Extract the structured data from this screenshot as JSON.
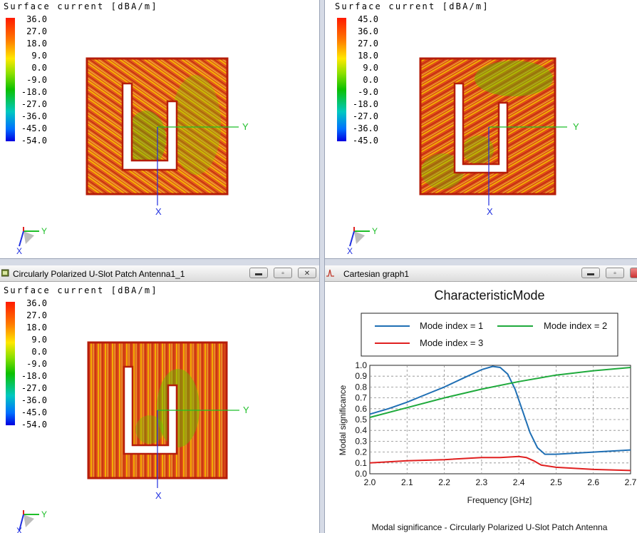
{
  "scale_title": "Surface current [dBA/m]",
  "panels": [
    {
      "scale": [
        "36.0",
        "27.0",
        "18.0",
        "9.0",
        "0.0",
        "-9.0",
        "-18.0",
        "-27.0",
        "-36.0",
        "-45.0",
        "-54.0"
      ],
      "axis_y": "Y",
      "axis_x": "X",
      "triad_y": "Y",
      "triad_x": "X"
    },
    {
      "scale": [
        "45.0",
        "36.0",
        "27.0",
        "18.0",
        "9.0",
        "0.0",
        "-9.0",
        "-18.0",
        "-27.0",
        "-36.0",
        "-45.0"
      ],
      "axis_y": "Y",
      "axis_x": "X",
      "triad_y": "Y",
      "triad_x": "X"
    },
    {
      "window_title": "Circularly Polarized  U-Slot Patch Antenna1_1",
      "scale": [
        "36.0",
        "27.0",
        "18.0",
        "9.0",
        "0.0",
        "-9.0",
        "-18.0",
        "-27.0",
        "-36.0",
        "-45.0",
        "-54.0"
      ],
      "axis_y": "Y",
      "axis_x": "X",
      "triad_y": "Y",
      "triad_x": "X"
    }
  ],
  "graph_window": {
    "title": "Cartesian graph1"
  },
  "colors": {
    "mode1": "#1f6fb4",
    "mode2": "#1faa3c",
    "mode3": "#e02020",
    "surface": "#d42a10",
    "titlebar": "#e4e4e4"
  },
  "chart_data": {
    "type": "line",
    "title": "CharacteristicMode",
    "xlabel": "Frequency [GHz]",
    "ylabel": "Modal significance",
    "caption": "Modal significance - Circularly Polarized U-Slot Patch Antenna",
    "xlim": [
      2.0,
      2.7
    ],
    "ylim": [
      0.0,
      1.0
    ],
    "xticks": [
      "2.0",
      "2.1",
      "2.2",
      "2.3",
      "2.4",
      "2.5",
      "2.6",
      "2.7"
    ],
    "yticks": [
      "0.0",
      "0.1",
      "0.2",
      "0.3",
      "0.4",
      "0.5",
      "0.6",
      "0.7",
      "0.8",
      "0.9",
      "1.0"
    ],
    "grid": true,
    "legend_position": "top",
    "series": [
      {
        "name": "Mode index = 1",
        "color": "#1f6fb4",
        "x": [
          2.0,
          2.05,
          2.1,
          2.15,
          2.2,
          2.25,
          2.3,
          2.33,
          2.35,
          2.37,
          2.39,
          2.41,
          2.43,
          2.45,
          2.47,
          2.5,
          2.55,
          2.6,
          2.65,
          2.7
        ],
        "y": [
          0.55,
          0.6,
          0.66,
          0.73,
          0.8,
          0.88,
          0.96,
          0.99,
          0.98,
          0.92,
          0.78,
          0.58,
          0.38,
          0.24,
          0.18,
          0.18,
          0.19,
          0.2,
          0.21,
          0.22
        ]
      },
      {
        "name": "Mode index = 2",
        "color": "#1faa3c",
        "x": [
          2.0,
          2.1,
          2.2,
          2.3,
          2.4,
          2.5,
          2.6,
          2.7
        ],
        "y": [
          0.52,
          0.61,
          0.7,
          0.78,
          0.85,
          0.91,
          0.95,
          0.98
        ]
      },
      {
        "name": "Mode index = 3",
        "color": "#e02020",
        "x": [
          2.0,
          2.1,
          2.2,
          2.3,
          2.35,
          2.4,
          2.42,
          2.44,
          2.46,
          2.5,
          2.6,
          2.7
        ],
        "y": [
          0.1,
          0.12,
          0.13,
          0.15,
          0.15,
          0.16,
          0.15,
          0.12,
          0.08,
          0.06,
          0.04,
          0.03
        ]
      }
    ]
  }
}
